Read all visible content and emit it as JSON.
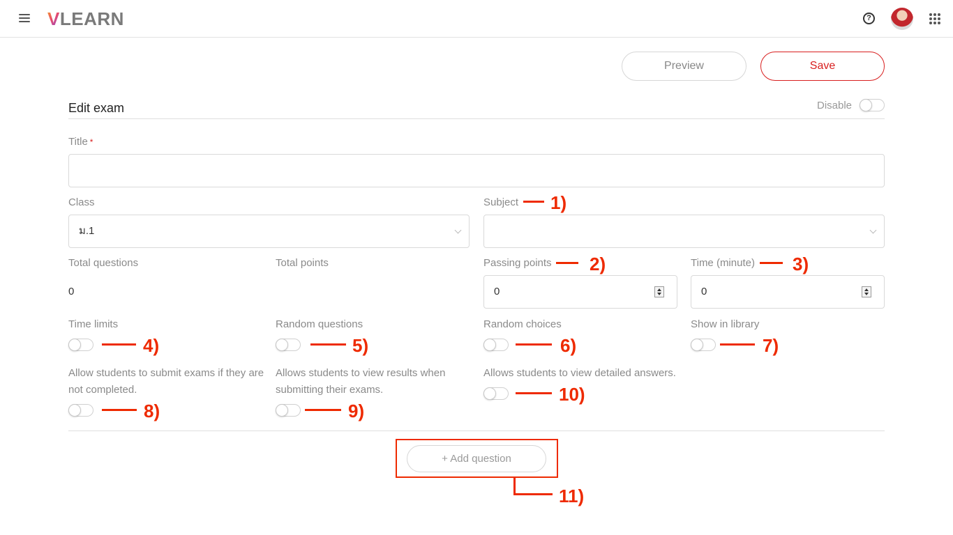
{
  "header": {
    "logo_v": "V",
    "logo_rest": "LEARN",
    "help_icon": "help-circle-icon",
    "avatar": "user-avatar",
    "apps_icon": "apps-grid-icon",
    "menu_icon": "hamburger-menu-icon"
  },
  "actions": {
    "preview_label": "Preview",
    "save_label": "Save"
  },
  "exam": {
    "section_title": "Edit exam",
    "disable_label": "Disable",
    "disable_on": false,
    "title_label": "Title",
    "title_required_mark": "*",
    "title_value": "",
    "class_label": "Class",
    "class_value": "ม.1",
    "subject_label": "Subject",
    "subject_value": "",
    "total_questions_label": "Total questions",
    "total_questions_value": "0",
    "total_points_label": "Total points",
    "total_points_value": "",
    "passing_points_label": "Passing points",
    "passing_points_value": "0",
    "time_label": "Time (minute)",
    "time_value": "0",
    "toggles": {
      "time_limits": {
        "label": "Time limits",
        "on": false
      },
      "random_questions": {
        "label": "Random questions",
        "on": false
      },
      "random_choices": {
        "label": "Random choices",
        "on": false
      },
      "show_in_library": {
        "label": "Show in library",
        "on": false
      },
      "allow_incomplete_line1": "Allow students to submit exams if they are",
      "allow_incomplete_line2": "not completed.",
      "view_results_line1": "Allows students to view results when",
      "view_results_line2": "submitting their exams.",
      "view_detailed": "Allows students to view detailed answers."
    },
    "add_question_label": "+ Add question"
  },
  "annotations": [
    "1)",
    "2)",
    "3)",
    "4)",
    "5)",
    "6)",
    "7)",
    "8)",
    "9)",
    "10)",
    "11)"
  ],
  "colors": {
    "accent_red": "#d81e1e",
    "annotation_red": "#ee2a00"
  }
}
